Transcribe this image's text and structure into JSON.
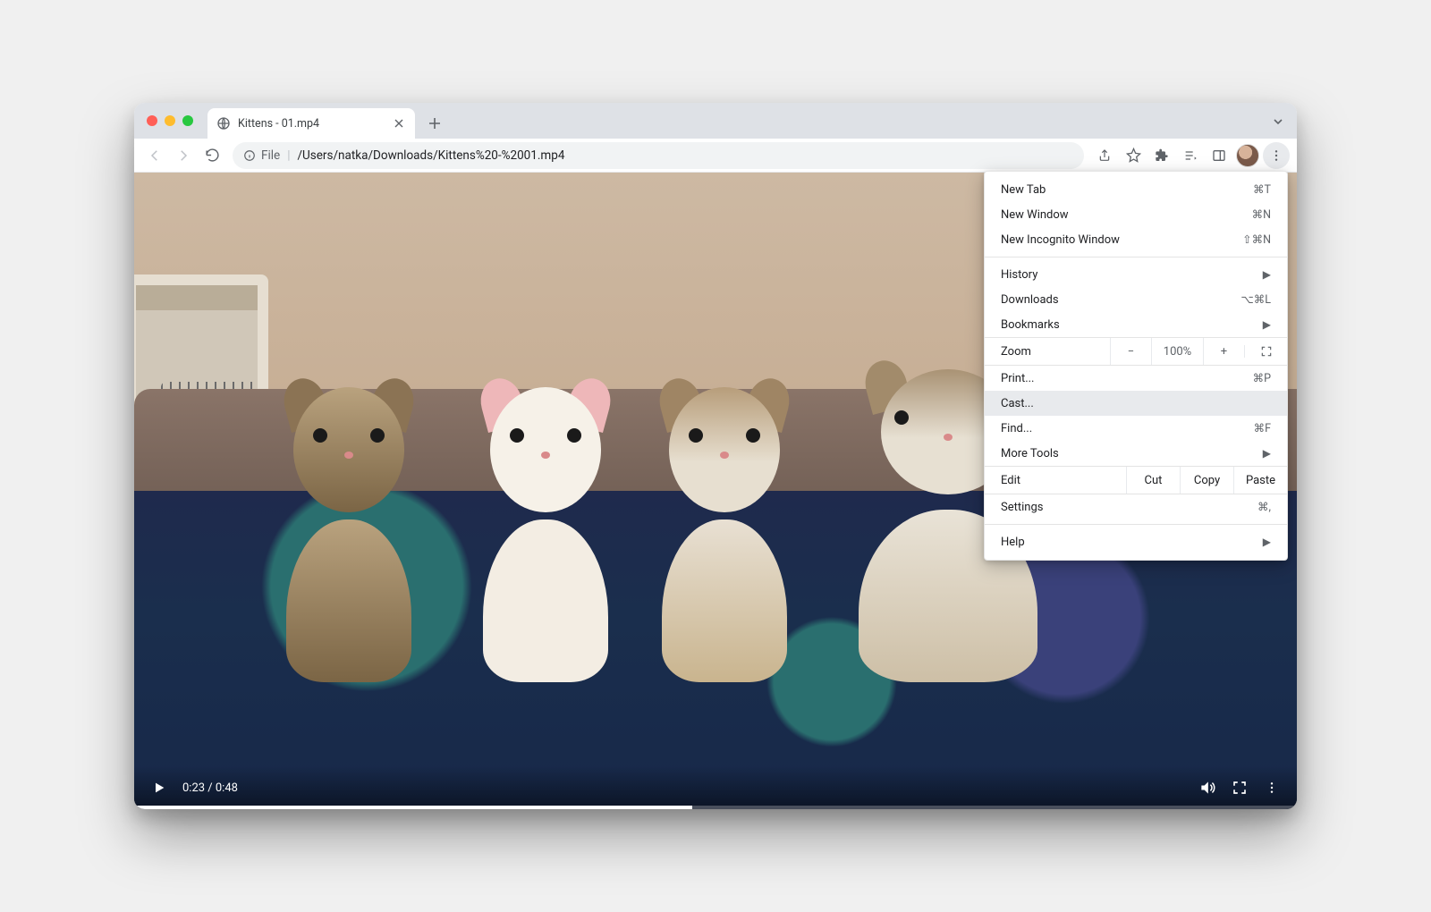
{
  "tab": {
    "title": "Kittens - 01.mp4"
  },
  "omnibox": {
    "scheme": "File",
    "path": "/Users/natka/Downloads/Kittens%20-%2001.mp4"
  },
  "video": {
    "current_time": "0:23",
    "duration": "0:48",
    "time_display": "0:23 / 0:48"
  },
  "menu": {
    "new_tab": {
      "label": "New Tab",
      "shortcut": "⌘T"
    },
    "new_window": {
      "label": "New Window",
      "shortcut": "⌘N"
    },
    "new_incognito": {
      "label": "New Incognito Window",
      "shortcut": "⇧⌘N"
    },
    "history": {
      "label": "History"
    },
    "downloads": {
      "label": "Downloads",
      "shortcut": "⌥⌘L"
    },
    "bookmarks": {
      "label": "Bookmarks"
    },
    "zoom": {
      "label": "Zoom",
      "value": "100%"
    },
    "print": {
      "label": "Print...",
      "shortcut": "⌘P"
    },
    "cast": {
      "label": "Cast..."
    },
    "find": {
      "label": "Find...",
      "shortcut": "⌘F"
    },
    "more_tools": {
      "label": "More Tools"
    },
    "edit": {
      "label": "Edit",
      "cut": "Cut",
      "copy": "Copy",
      "paste": "Paste"
    },
    "settings": {
      "label": "Settings",
      "shortcut": "⌘,"
    },
    "help": {
      "label": "Help"
    }
  }
}
